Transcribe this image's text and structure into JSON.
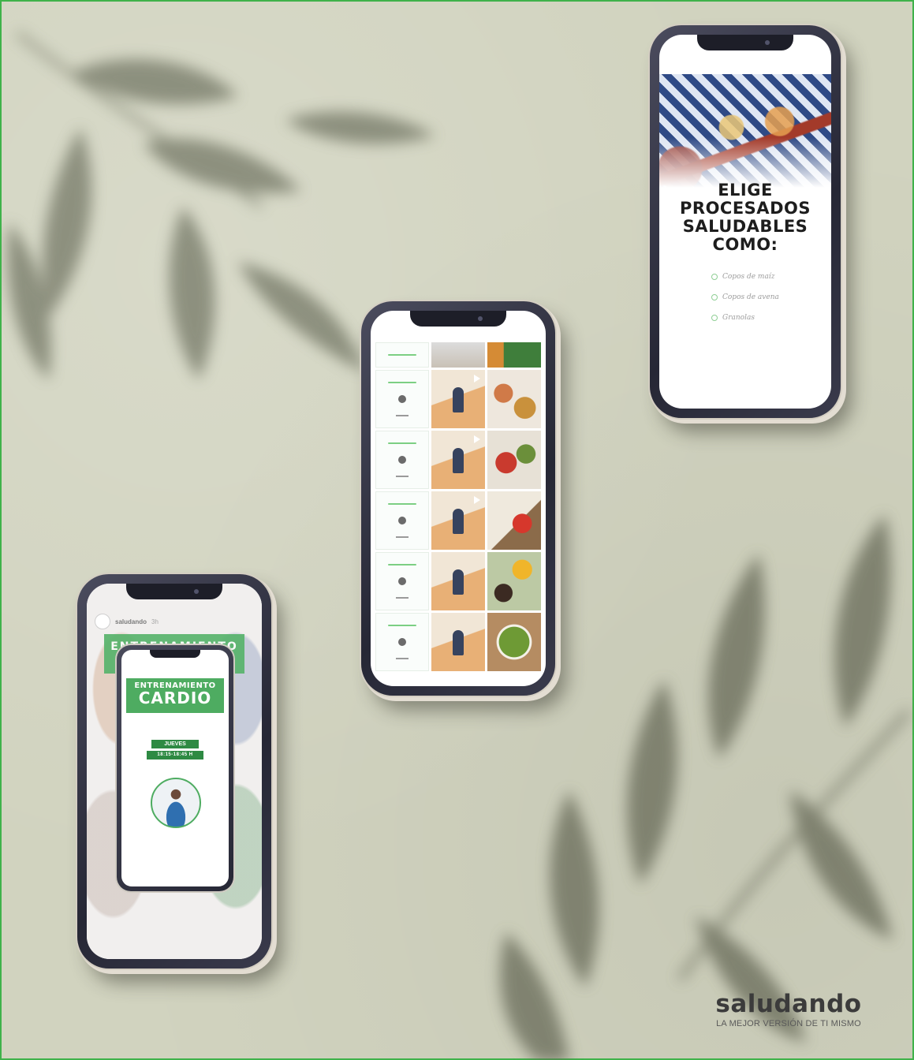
{
  "brand": {
    "name": "saludando",
    "tagline": "LA MEJOR VERSIÓN DE TI MISMO"
  },
  "phone_food": {
    "title_lines": [
      "ELIGE",
      "PROCESADOS",
      "SALUDABLES",
      "COMO:"
    ],
    "items": [
      "Copos de maíz",
      "Copos de avena",
      "Granolas"
    ]
  },
  "phone_cardio": {
    "username": "saludando",
    "time": "3h",
    "banner_small": "ENTRENAMIENTO",
    "banner_big": "CARDIO",
    "day": "JUEVES",
    "hour": "18:15-18:45 H"
  },
  "colors": {
    "background": "#d1d3bf",
    "accent_green": "#4eac61",
    "frame_border": "#3fb24a"
  }
}
